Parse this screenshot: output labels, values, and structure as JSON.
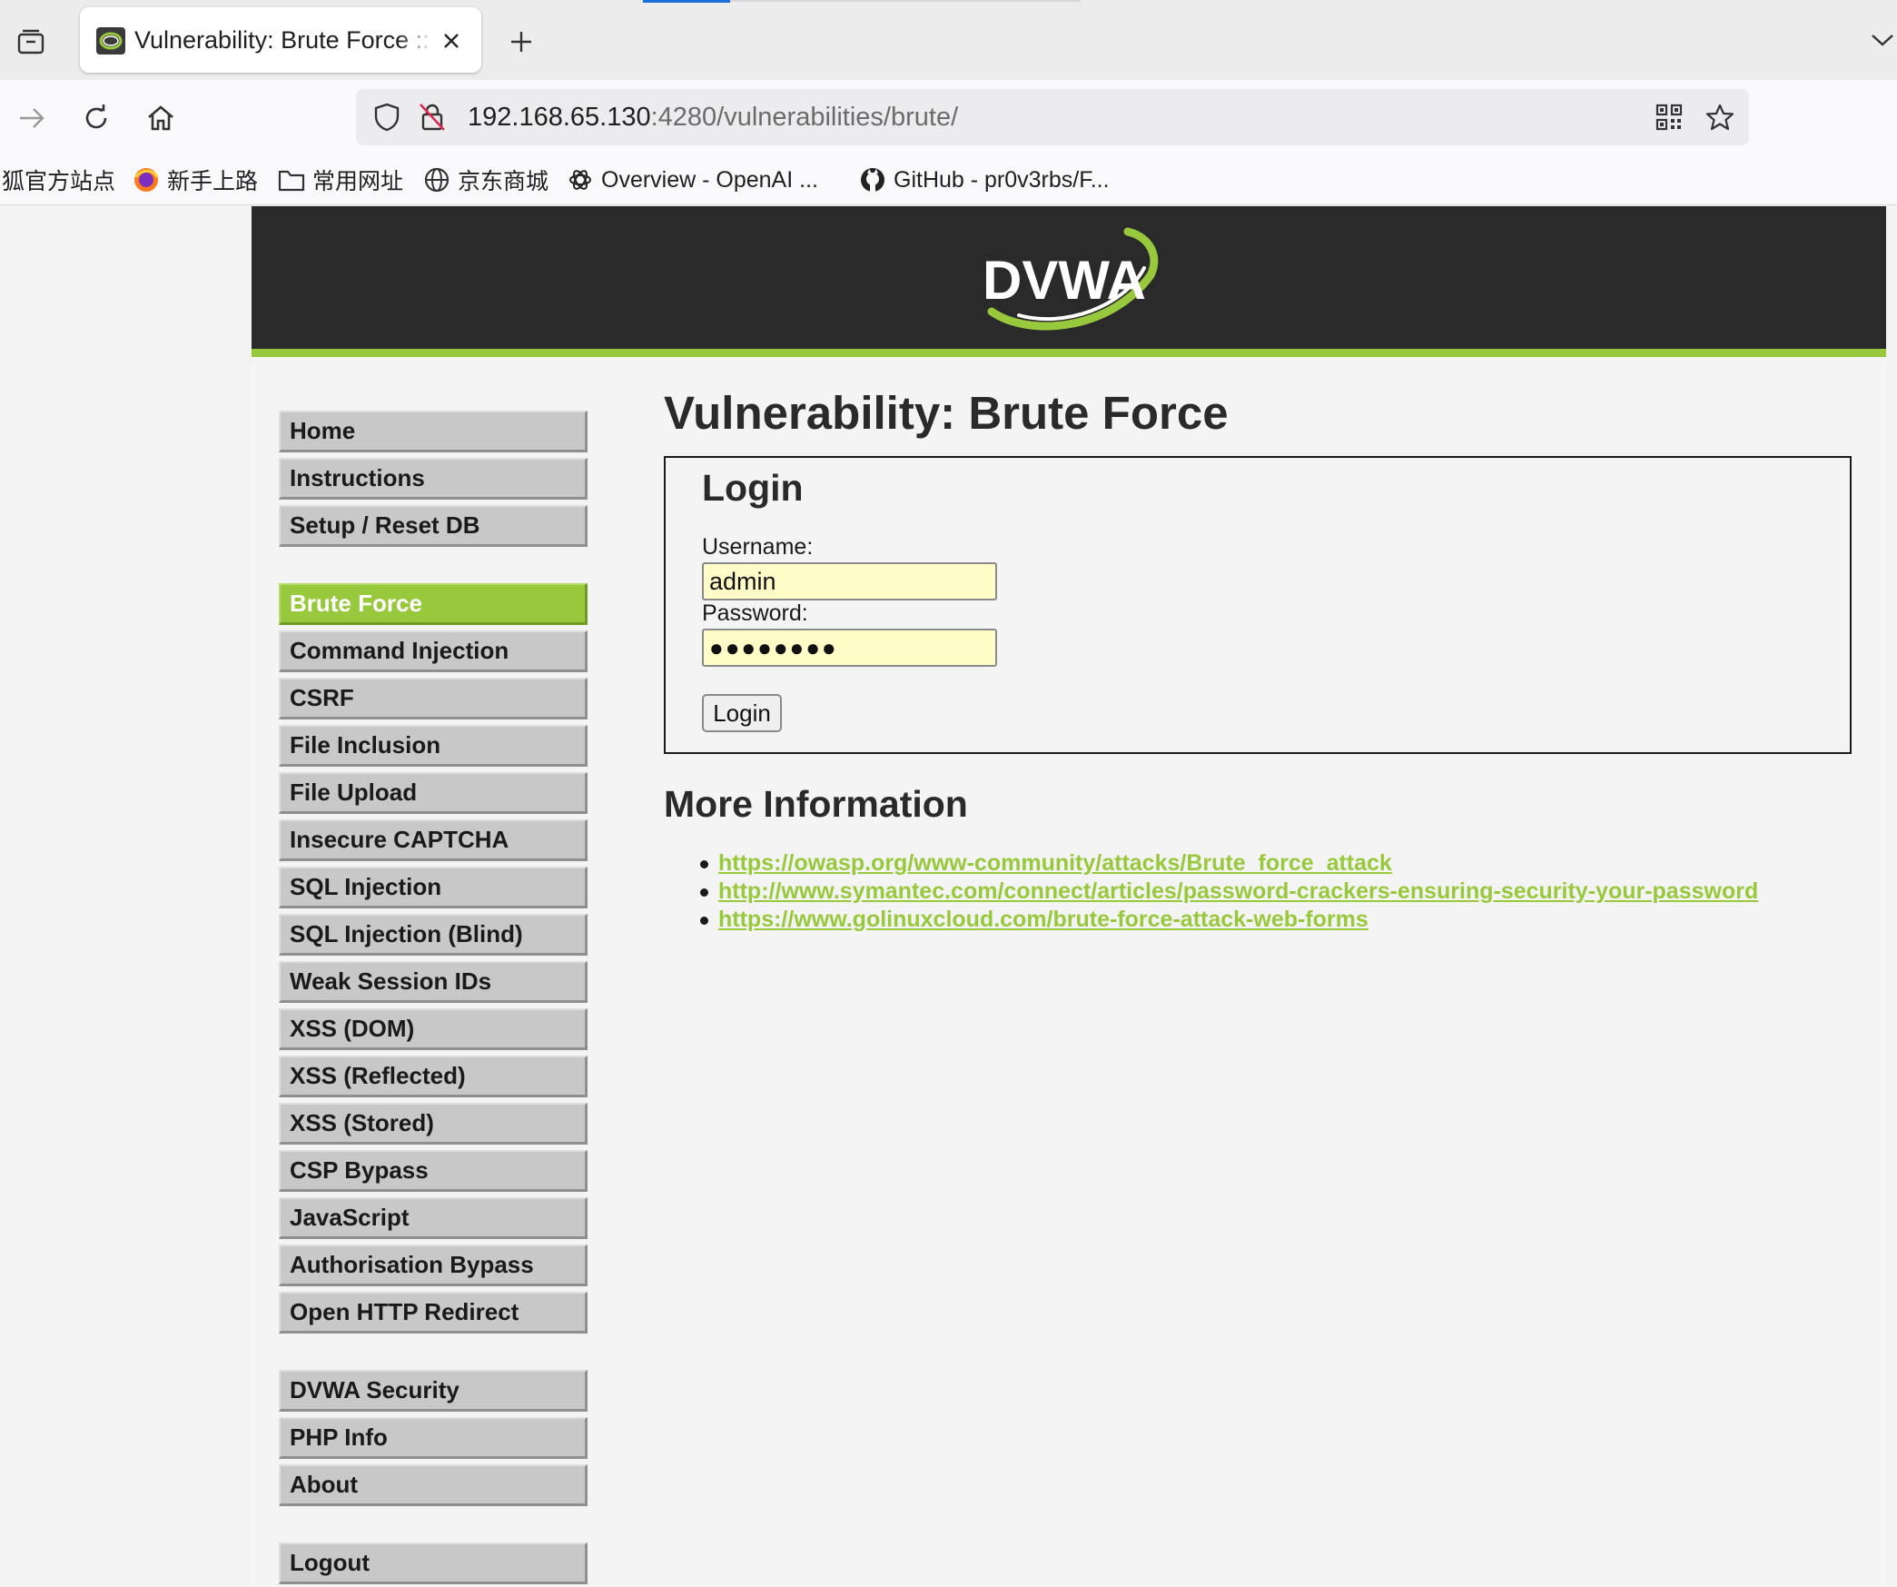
{
  "browser": {
    "tab_title": "Vulnerability: Brute Force :: DVWA",
    "url_host": "192.168.65.130",
    "url_path": ":4280/vulnerabilities/brute/",
    "bookmarks": [
      "狐官方站点",
      "新手上路",
      "常用网址",
      "京东商城",
      "Overview - OpenAI ...",
      "GitHub - pr0v3rbs/F..."
    ]
  },
  "logo": {
    "text": "DVWA"
  },
  "menu": {
    "group1": [
      "Home",
      "Instructions",
      "Setup / Reset DB"
    ],
    "group2": [
      "Brute Force",
      "Command Injection",
      "CSRF",
      "File Inclusion",
      "File Upload",
      "Insecure CAPTCHA",
      "SQL Injection",
      "SQL Injection (Blind)",
      "Weak Session IDs",
      "XSS (DOM)",
      "XSS (Reflected)",
      "XSS (Stored)",
      "CSP Bypass",
      "JavaScript",
      "Authorisation Bypass",
      "Open HTTP Redirect"
    ],
    "group3": [
      "DVWA Security",
      "PHP Info",
      "About"
    ],
    "group4": [
      "Logout"
    ],
    "active": "Brute Force"
  },
  "main": {
    "title": "Vulnerability: Brute Force",
    "login": {
      "heading": "Login",
      "username_label": "Username:",
      "username_value": "admin",
      "password_label": "Password:",
      "password_value": "●●●●●●●●",
      "button_label": "Login"
    },
    "more_info": {
      "heading": "More Information",
      "links": [
        "https://owasp.org/www-community/attacks/Brute_force_attack",
        "http://www.symantec.com/connect/articles/password-crackers-ensuring-security-your-password",
        "https://www.golinuxcloud.com/brute-force-attack-web-forms"
      ]
    }
  },
  "colors": {
    "accent_green": "#98c93c",
    "header_bg": "#2a2a2a",
    "input_bg": "#fffcc8"
  },
  "icons": [
    "tab-list-icon",
    "dvwa-favicon-icon",
    "close-icon",
    "plus-icon",
    "chevron-down-icon",
    "forward-arrow-icon",
    "reload-icon",
    "home-icon",
    "shield-icon",
    "insecure-lock-icon",
    "qr-code-icon",
    "star-icon",
    "fox-icon",
    "firefox-icon",
    "folder-icon",
    "globe-icon",
    "openai-icon",
    "github-icon"
  ]
}
